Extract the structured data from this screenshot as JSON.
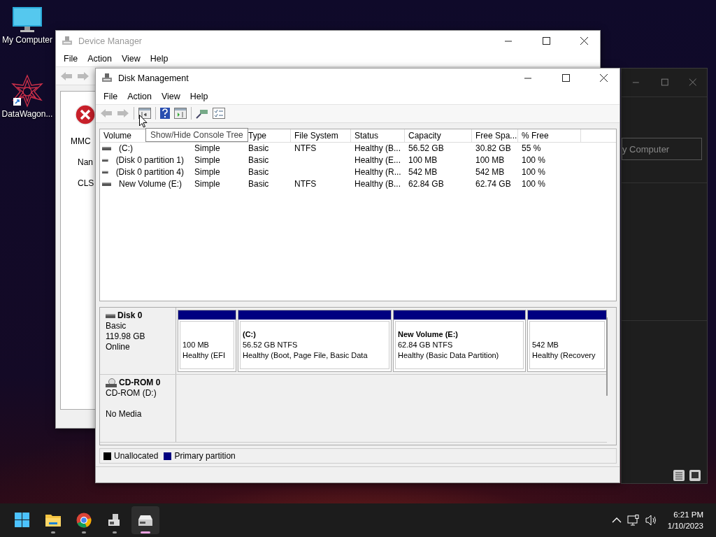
{
  "desktop_icons": [
    {
      "kind": "computer",
      "label": "My Computer"
    },
    {
      "kind": "shortcut",
      "label": "DataWagon..."
    }
  ],
  "device_manager": {
    "title": "Device Manager",
    "active": false,
    "menu": [
      "File",
      "Action",
      "View",
      "Help"
    ],
    "labels": [
      "MMC",
      "Nan",
      "CLS"
    ]
  },
  "back_window": {
    "field_text": "y Computer"
  },
  "disk_management": {
    "title": "Disk Management",
    "active": true,
    "menu": [
      "File",
      "Action",
      "View",
      "Help"
    ],
    "tooltip": "Show/Hide Console Tree",
    "table": {
      "columns": [
        "Volume",
        "Type",
        "File System",
        "Status",
        "Capacity",
        "Free Spa...",
        "% Free"
      ],
      "rows": [
        {
          "volume": "(C:)",
          "layout": "Simple",
          "type": "Basic",
          "file_system": "NTFS",
          "status": "Healthy (B...",
          "capacity": "56.52 GB",
          "free_space": "30.82 GB",
          "percent_free": "55 %"
        },
        {
          "volume": "(Disk 0 partition 1)",
          "layout": "Simple",
          "type": "Basic",
          "status": "Healthy (E...",
          "capacity": "100 MB",
          "free_space": "100 MB",
          "percent_free": "100 %"
        },
        {
          "volume": "(Disk 0 partition 4)",
          "layout": "Simple",
          "type": "Basic",
          "status": "Healthy (R...",
          "capacity": "542 MB",
          "free_space": "542 MB",
          "percent_free": "100 %"
        },
        {
          "volume": "New Volume (E:)",
          "layout": "Simple",
          "type": "Basic",
          "file_system": "NTFS",
          "status": "Healthy (B...",
          "capacity": "62.84 GB",
          "free_space": "62.74 GB",
          "percent_free": "100 %"
        }
      ]
    },
    "disks": [
      {
        "kind": "disk",
        "name": "Disk 0",
        "type": "Basic",
        "size": "119.98 GB",
        "status": "Online",
        "partitions": [
          {
            "size": "100 MB",
            "status": "Healthy (EFI"
          },
          {
            "label": "(C:)",
            "size": "56.52 GB NTFS",
            "status": "Healthy (Boot, Page File, Basic Data"
          },
          {
            "label": "New Volume  (E:)",
            "size": "62.84 GB NTFS",
            "status": "Healthy (Basic Data Partition)"
          },
          {
            "size": "542 MB",
            "status": "Healthy (Recovery"
          }
        ]
      },
      {
        "kind": "cdrom",
        "name": "CD-ROM 0",
        "type": "CD-ROM (D:)",
        "status": "No Media"
      }
    ],
    "legend": [
      {
        "label": "Unallocated",
        "color": "#000000"
      },
      {
        "label": "Primary partition",
        "color": "#000080"
      }
    ]
  },
  "taskbar": {
    "items": [
      {
        "kind": "start",
        "running": false,
        "selected": false
      },
      {
        "kind": "explorer",
        "running": true,
        "selected": false
      },
      {
        "kind": "browser",
        "running": true,
        "selected": false
      },
      {
        "kind": "device_manager",
        "running": true,
        "selected": false
      },
      {
        "kind": "disk_management",
        "running": true,
        "selected": true
      }
    ],
    "time": "6:21 PM",
    "date": "1/10/2023"
  }
}
